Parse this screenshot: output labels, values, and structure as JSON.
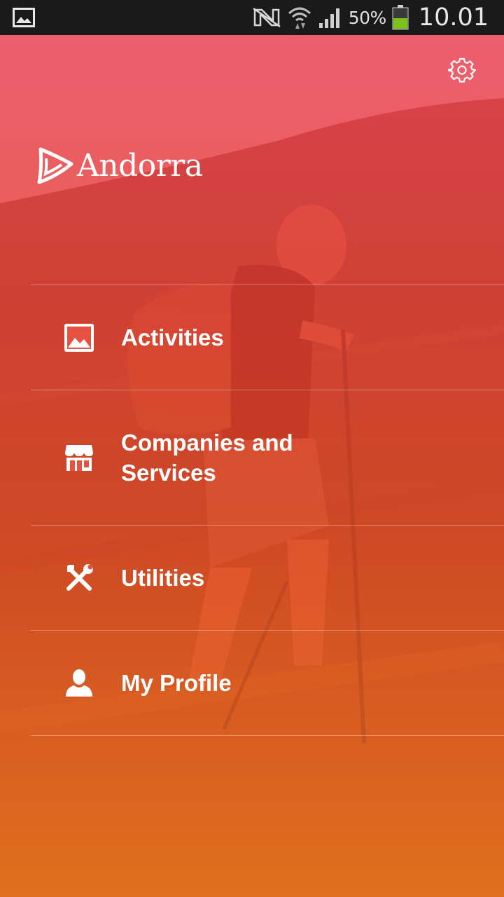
{
  "status_bar": {
    "battery_percent": "50%",
    "time": "10.01",
    "icons": [
      "gallery-icon",
      "nfc-icon",
      "wifi-icon",
      "signal-icon",
      "battery-icon"
    ]
  },
  "app": {
    "logo_text": "Andorra",
    "settings_icon": "gear-icon"
  },
  "menu": {
    "items": [
      {
        "label": "Activities",
        "icon": "image-icon"
      },
      {
        "label": "Companies and Services",
        "icon": "store-icon"
      },
      {
        "label": "Utilities",
        "icon": "tools-icon"
      },
      {
        "label": "My Profile",
        "icon": "user-icon"
      }
    ]
  },
  "colors": {
    "overlay_top": "#ec3e52",
    "overlay_bottom": "#ec6e18",
    "status_bar": "#1a1a1a",
    "text": "#ffffff"
  }
}
